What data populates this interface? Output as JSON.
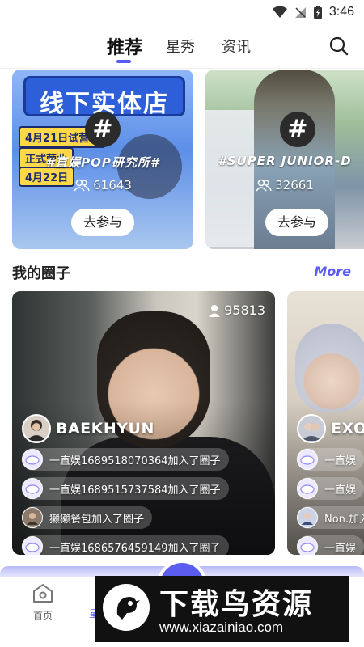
{
  "status_bar": {
    "time": "3:46",
    "icons": [
      "wifi-icon",
      "signal-icon",
      "battery-icon"
    ]
  },
  "top_nav": {
    "tabs": [
      {
        "label": "推荐",
        "active": true
      },
      {
        "label": "星秀",
        "active": false
      },
      {
        "label": "资讯",
        "active": false
      }
    ],
    "accent_color": "#5b5cf0"
  },
  "topics": [
    {
      "banner_text": "线下实体店",
      "tag1": "4月21日试营业",
      "tag2": "正式营业",
      "tag3": "4月22日",
      "title": "#直娱POP研究所#",
      "count": "61643",
      "join_label": "去参与"
    },
    {
      "title": "#SUPER JUNIOR-D",
      "count": "32661",
      "join_label": "去参与"
    }
  ],
  "my_circles": {
    "title": "我的圈子",
    "more_label": "More",
    "cards": [
      {
        "name": "BAEKHYUN",
        "member_count": "95813",
        "feed": [
          "一直娱1689518070364加入了圈子",
          "一直娱1689515737584加入了圈子",
          "獭獭餐包加入了圈子",
          "一直娱1686576459149加入了圈子"
        ]
      },
      {
        "name": "EXO-",
        "feed": [
          "一直娱",
          "一直娱",
          "Non.加入",
          "一直娱"
        ]
      }
    ]
  },
  "bottom_nav": {
    "items": [
      {
        "label": "首页",
        "active": false
      },
      {
        "label": "星",
        "active": true
      }
    ]
  },
  "watermark": {
    "title": "下载鸟资源",
    "url": "www.xiazainiao.com"
  }
}
